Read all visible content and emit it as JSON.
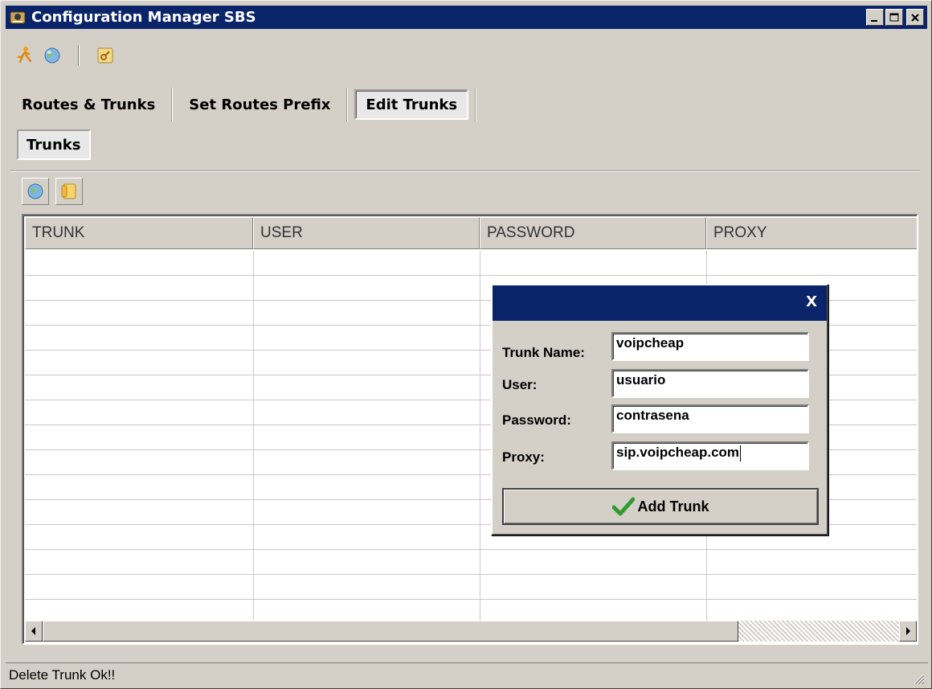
{
  "window": {
    "title": "Configuration Manager SBS",
    "controls": [
      "_",
      "□",
      "×"
    ]
  },
  "toolbar": {
    "icons": [
      "user-run-icon",
      "globe-icon",
      "key-icon"
    ]
  },
  "tabs": [
    {
      "label": "Routes & Trunks",
      "active": false
    },
    {
      "label": "Set Routes Prefix",
      "active": false
    },
    {
      "label": "Edit Trunks",
      "active": true
    }
  ],
  "subtab": {
    "label": "Trunks"
  },
  "grid_toolbar": {
    "icons": [
      "globe-icon",
      "notes-icon"
    ]
  },
  "grid": {
    "columns": [
      "TRUNK",
      "USER",
      "PASSWORD",
      "PROXY"
    ],
    "rows": []
  },
  "dialog": {
    "close_label": "X",
    "fields": {
      "trunk_name": {
        "label": "Trunk Name:",
        "value": "voipcheap"
      },
      "user": {
        "label": "User:",
        "value": "usuario"
      },
      "password": {
        "label": "Password:",
        "value": "contrasena"
      },
      "proxy": {
        "label": "Proxy:",
        "value": "sip.voipcheap.com"
      }
    },
    "submit_label": "Add Trunk"
  },
  "status": {
    "text": "Delete Trunk Ok!!"
  },
  "colors": {
    "titlebar": "#0a246a",
    "face": "#d4d0c8",
    "checkmark": "#2e9a2e"
  }
}
